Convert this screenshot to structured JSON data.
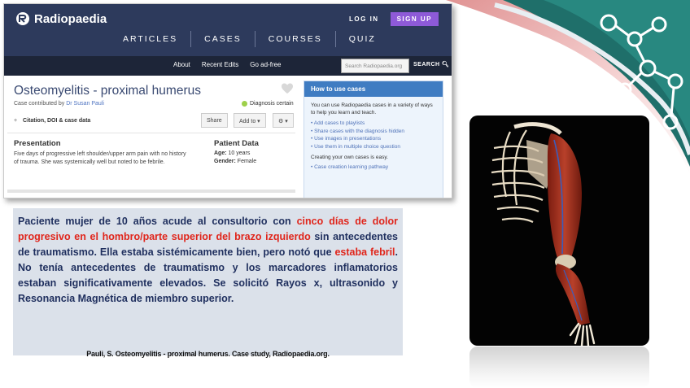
{
  "site": {
    "logo_text": "Radiopaedia",
    "login_label": "LOG IN",
    "signup_label": "SIGN UP",
    "nav": [
      "ARTICLES",
      "CASES",
      "COURSES",
      "QUIZ"
    ],
    "subnav": [
      "About",
      "Recent Edits",
      "Go ad-free"
    ],
    "search_placeholder": "Search Radiopaedia.org",
    "search_button": "SEARCH"
  },
  "case": {
    "title": "Osteomyelitis - proximal humerus",
    "contributed_prefix": "Case contributed by",
    "author": "Dr Susan Pauli",
    "diagnosis_status": "Diagnosis certain",
    "citation_label": "Citation, DOI & case data",
    "share_label": "Share",
    "add_to_label": "Add to ▾",
    "settings_label": "⚙ ▾",
    "presentation_heading": "Presentation",
    "presentation_text": "Five days of progressive left shoulder/upper arm pain with no history of trauma. She was systemically well but noted to be febrile.",
    "patient_data_heading": "Patient Data",
    "age_label": "Age:",
    "age_value": "10 years",
    "gender_label": "Gender:",
    "gender_value": "Female"
  },
  "how_to": {
    "heading": "How to use cases",
    "intro": "You can use Radiopaedia cases in a variety of ways to help you learn and teach.",
    "items": [
      "Add cases to playlists",
      "Share cases with the diagnosis hidden",
      "Use images in presentations",
      "Use them in multiple choice question"
    ],
    "creating": "Creating your own cases is easy.",
    "pathway": "Case creation learning pathway"
  },
  "description": {
    "p1": "Paciente mujer de 10 años acude al consultorio con ",
    "red1": "cinco días de dolor progresivo en el hombro/parte superior del brazo izquierdo",
    "p2": " sin antecedentes de traumatismo. Ella estaba sistémicamente bien, pero notó que ",
    "red2": "estaba febril",
    "p3": ". No tenía antecedentes de traumatismo y los marcadores inflamatorios estaban significativamente elevados. Se solicitó Rayos x, ultrasonido y Resonancia Magnética de miembro superior."
  },
  "credit": "Pauli, S. Osteomyelitis - proximal humerus. Case study, Radiopaedia.org.",
  "colors": {
    "navy": "#2d3a5c",
    "signup": "#8e5ad8",
    "highlight_red": "#e0251b",
    "desc_text": "#1f2f5e",
    "desc_bg": "#dbe1ea"
  }
}
